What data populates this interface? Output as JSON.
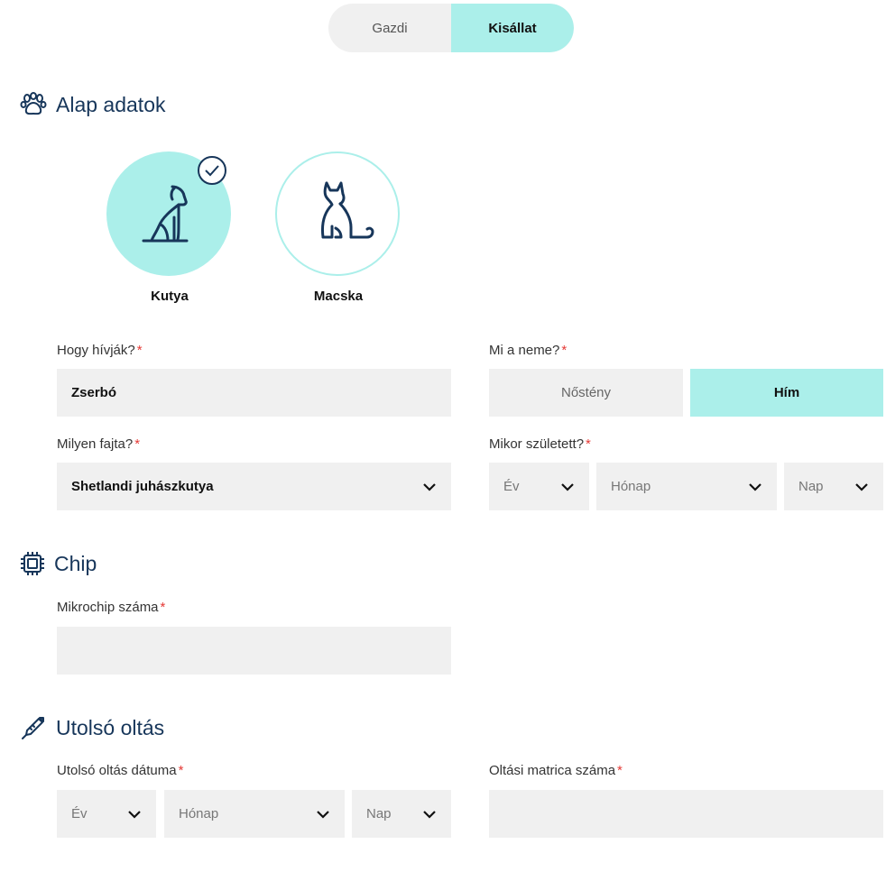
{
  "tabs": [
    {
      "label": "Gazdi",
      "active": false
    },
    {
      "label": "Kisállat",
      "active": true
    }
  ],
  "sections": {
    "basic": "Alap adatok",
    "chip": "Chip",
    "vaccination": "Utolsó oltás"
  },
  "pets": [
    {
      "label": "Kutya",
      "selected": true,
      "icon": "dog-icon"
    },
    {
      "label": "Macska",
      "selected": false,
      "icon": "cat-icon"
    }
  ],
  "form": {
    "name_label": "Hogy hívják?",
    "name_value": "Zserbó",
    "gender_label": "Mi a neme?",
    "gender_options": [
      "Nőstény",
      "Hím"
    ],
    "gender_selected": "Hím",
    "breed_label": "Milyen fajta?",
    "breed_value": "Shetlandi juhászkutya",
    "birth_label": "Mikor született?",
    "year_placeholder": "Év",
    "month_placeholder": "Hónap",
    "day_placeholder": "Nap",
    "chip_label": "Mikrochip száma",
    "chip_value": "",
    "vacc_date_label": "Utolsó oltás dátuma",
    "vacc_sticker_label": "Oltási matrica száma",
    "vacc_sticker_value": "",
    "required_mark": "*"
  },
  "colors": {
    "accent": "#abefea",
    "heading": "#17365a",
    "field_bg": "#f0f0f0",
    "required": "#e53935"
  }
}
